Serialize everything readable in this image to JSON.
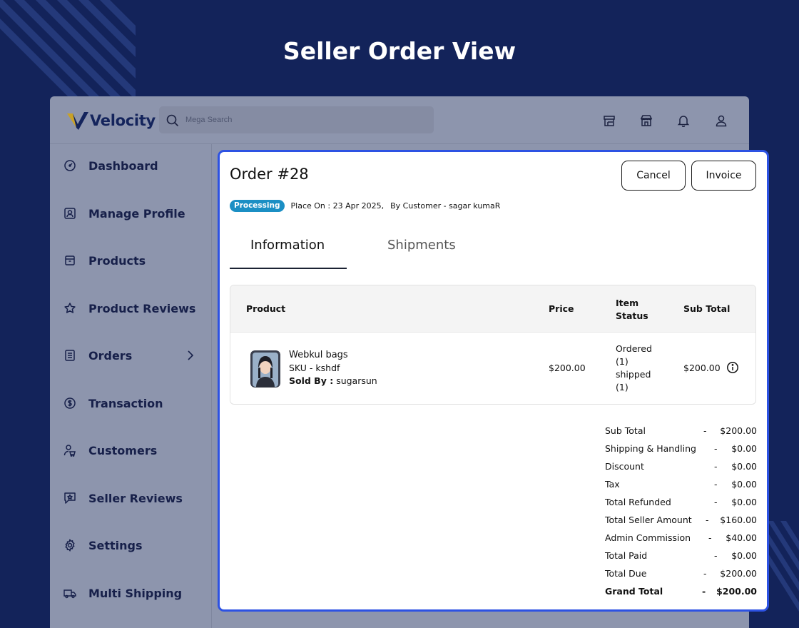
{
  "page": {
    "title": "Seller Order View"
  },
  "brand": {
    "name": "Velocity"
  },
  "search": {
    "placeholder": "Mega Search"
  },
  "topbar_icons": [
    "store-icon",
    "shop-icon",
    "bell-icon",
    "user-icon"
  ],
  "sidebar": {
    "items": [
      {
        "label": "Dashboard",
        "icon": "dashboard-icon"
      },
      {
        "label": "Manage Profile",
        "icon": "profile-icon"
      },
      {
        "label": "Products",
        "icon": "box-icon"
      },
      {
        "label": "Product Reviews",
        "icon": "star-icon"
      },
      {
        "label": "Orders",
        "icon": "orders-icon"
      },
      {
        "label": "Transaction",
        "icon": "dollar-icon"
      },
      {
        "label": "Customers",
        "icon": "customers-icon"
      },
      {
        "label": "Seller Reviews",
        "icon": "review-icon"
      },
      {
        "label": "Settings",
        "icon": "gear-icon"
      },
      {
        "label": "Multi Shipping",
        "icon": "truck-icon"
      }
    ]
  },
  "order": {
    "title": "Order #28",
    "status": "Processing",
    "placed_on": "Place On : 23 Apr 2025,",
    "customer": "By Customer - sagar kumaR",
    "cancel_label": "Cancel",
    "invoice_label": "Invoice"
  },
  "tabs": [
    {
      "label": "Information",
      "active": true
    },
    {
      "label": "Shipments",
      "active": false
    }
  ],
  "table": {
    "headers": [
      "Product",
      "Price",
      "Item Status",
      "Sub Total"
    ],
    "rows": [
      {
        "name": "Webkul bags",
        "sku": "SKU - kshdf",
        "sold_by_label": "Sold By :",
        "sold_by": "sugarsun",
        "price": "$200.00",
        "status_lines": [
          "Ordered",
          "(1)",
          "shipped",
          "(1)"
        ],
        "subtotal": "$200.00"
      }
    ]
  },
  "summary": [
    {
      "label": "Sub Total",
      "value": "$200.00"
    },
    {
      "label": "Shipping & Handling",
      "value": "$0.00"
    },
    {
      "label": "Discount",
      "value": "$0.00"
    },
    {
      "label": "Tax",
      "value": "$0.00"
    },
    {
      "label": "Total Refunded",
      "value": "$0.00"
    },
    {
      "label": "Total Seller Amount",
      "value": "$160.00"
    },
    {
      "label": "Admin Commission",
      "value": "$40.00"
    },
    {
      "label": "Total Paid",
      "value": "$0.00"
    },
    {
      "label": "Total Due",
      "value": "$200.00"
    },
    {
      "label": "Grand Total",
      "value": "$200.00"
    }
  ],
  "summary_separator": "-",
  "colors": {
    "background": "#13235a",
    "accent_border": "#2d52e3",
    "badge": "#1b8fc4",
    "brand_text": "#14245c",
    "logo_gold": "#c9a227"
  }
}
